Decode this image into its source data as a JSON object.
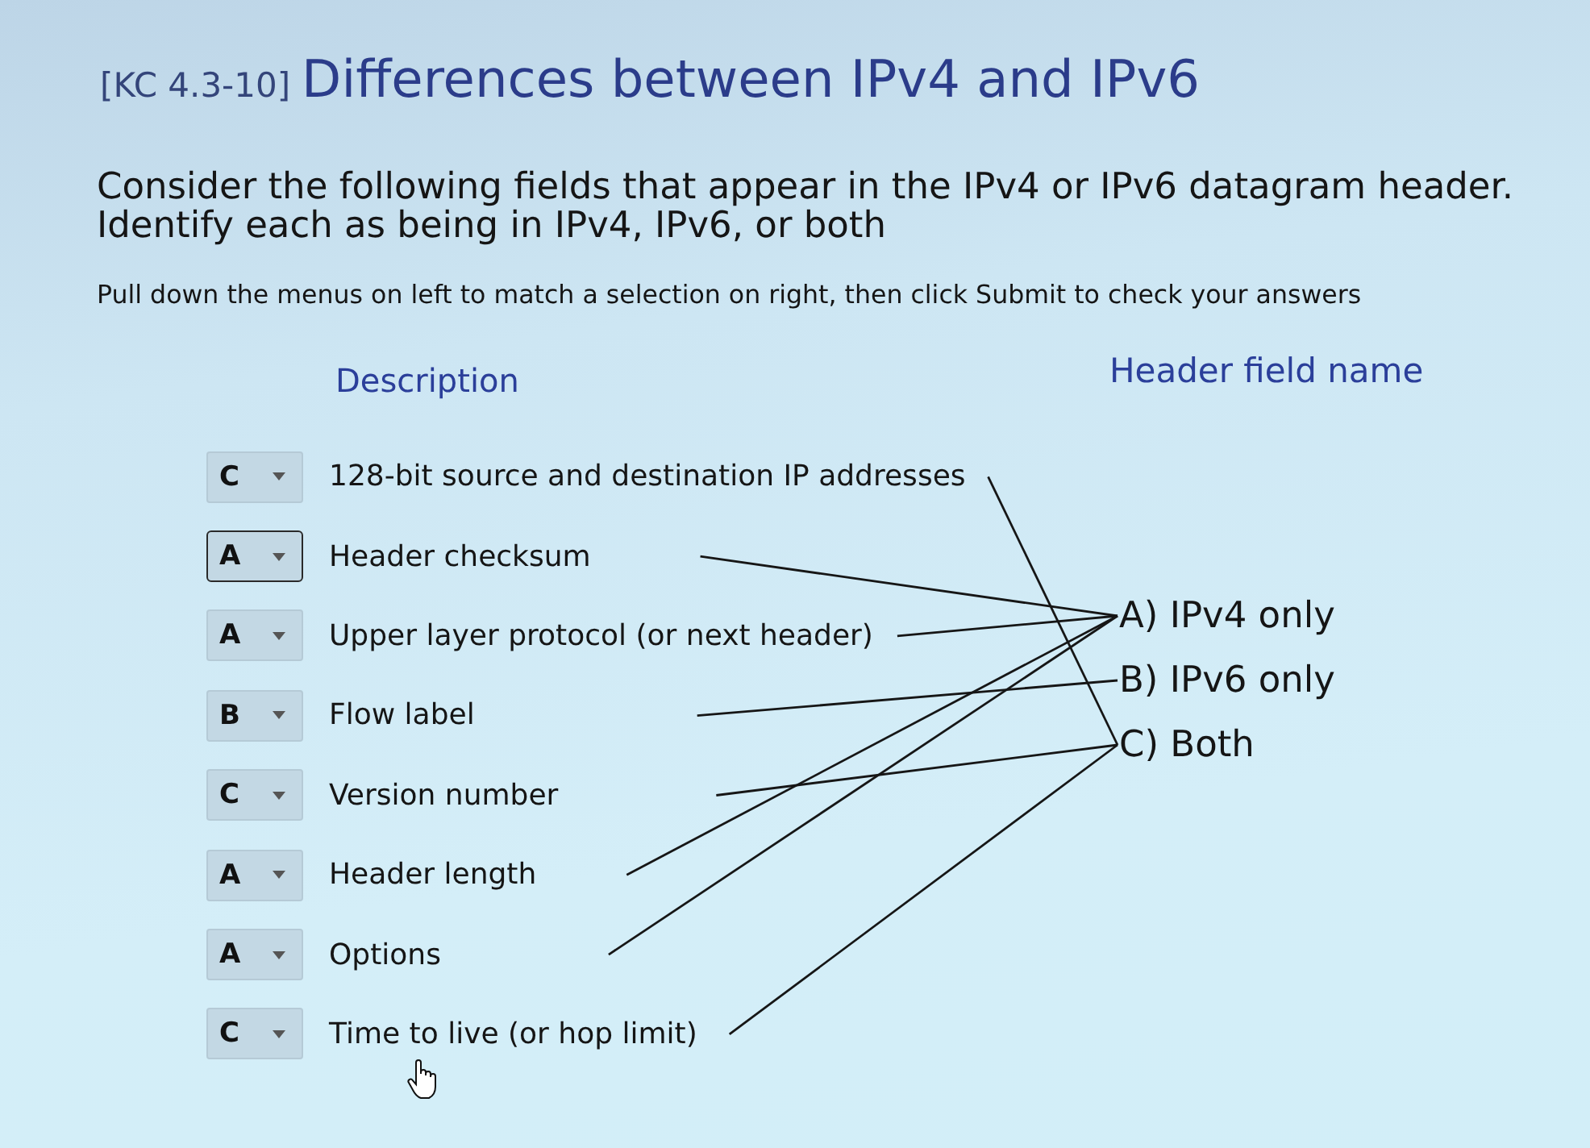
{
  "header": {
    "code": "[KC 4.3-10]",
    "title": "Differences between IPv4 and IPv6"
  },
  "instructions": [
    "Consider the following fields that appear in the IPv4 or IPv6 datagram header.",
    "Identify each as being in IPv4, IPv6, or both"
  ],
  "hint": "Pull down the menus on left to match a selection on right, then click Submit to check your answers",
  "matching": {
    "description_heading": "Description",
    "answer_heading": "Header field name",
    "items": [
      {
        "choice": "C",
        "text": "128-bit source and destination IP addresses",
        "focused": false,
        "kind": "to_c"
      },
      {
        "choice": "A",
        "text": "Header checksum",
        "focused": true,
        "kind": "to_a"
      },
      {
        "choice": "A",
        "text": "Upper layer protocol (or next header)",
        "focused": false,
        "kind": "to_a"
      },
      {
        "choice": "B",
        "text": "Flow label",
        "focused": false,
        "kind": "to_b"
      },
      {
        "choice": "C",
        "text": "Version number",
        "focused": false,
        "kind": "to_c"
      },
      {
        "choice": "A",
        "text": "Header length",
        "focused": false,
        "kind": "to_a"
      },
      {
        "choice": "A",
        "text": "Options",
        "focused": false,
        "kind": "to_a"
      },
      {
        "choice": "C",
        "text": "Time to live (or hop limit)",
        "focused": false,
        "kind": "to_c"
      }
    ],
    "answers": [
      {
        "label": "A) IPv4 only"
      },
      {
        "label": "B) IPv6 only"
      },
      {
        "label": "C) Both"
      }
    ]
  }
}
